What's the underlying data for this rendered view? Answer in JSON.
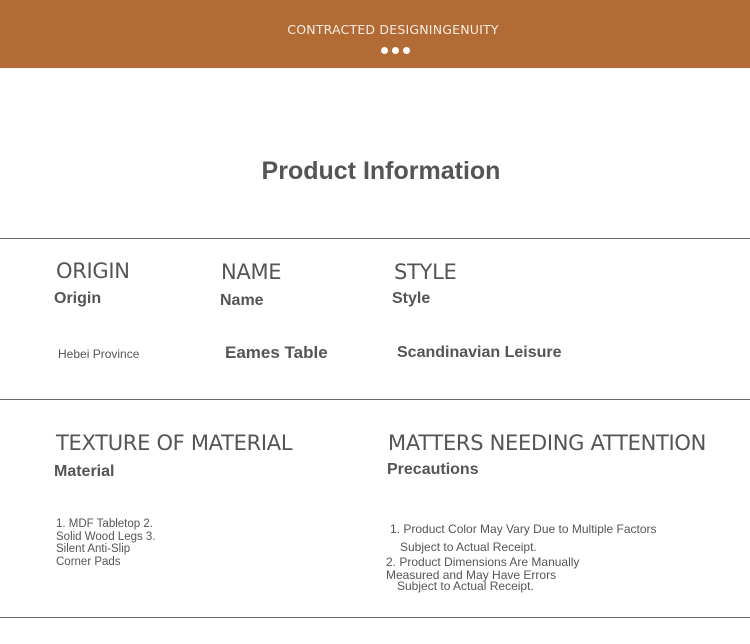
{
  "banner": {
    "title": "CONTRACTED DESIGNINGENUITY"
  },
  "section_title": "Product Information",
  "specs": {
    "origin": {
      "heading": "ORIGIN",
      "label": "Origin",
      "value": "Hebei Province"
    },
    "name": {
      "heading": "NAME",
      "label": "Name",
      "value": "Eames Table"
    },
    "style": {
      "heading": "STYLE",
      "label": "Style",
      "value": "Scandinavian Leisure"
    }
  },
  "material": {
    "heading": "TEXTURE OF MATERIAL",
    "label": "Material",
    "text": "1. MDF Tabletop 2. Solid Wood Legs 3. Silent Anti-Slip Corner Pads"
  },
  "precautions": {
    "heading": "MATTERS NEEDING ATTENTION",
    "label": "Precautions",
    "lines": [
      "1. Product Color May Vary Due to Multiple Factors",
      "Subject to Actual Receipt.",
      "2. Product Dimensions Are Manually",
      "Measured and May Have Errors",
      "Subject to Actual Receipt."
    ]
  },
  "colors": {
    "banner": "#b26b35",
    "text": "#555555",
    "rule": "#6b6b6b"
  }
}
